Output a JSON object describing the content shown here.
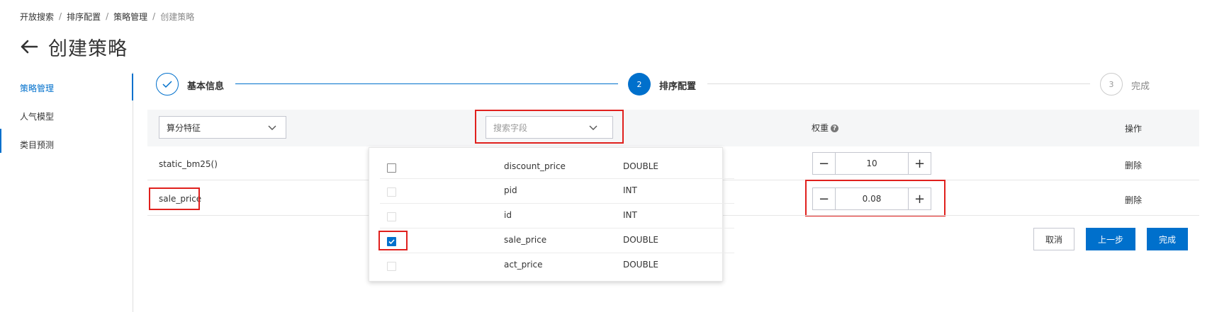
{
  "breadcrumb": [
    "开放搜索",
    "排序配置",
    "策略管理",
    "创建策略"
  ],
  "breadcrumb_sep": "/",
  "page_title": "创建策略",
  "sidebar": {
    "items": [
      {
        "label": "策略管理",
        "active": true
      },
      {
        "label": "人气模型",
        "active": false
      },
      {
        "label": "类目预测",
        "active": false
      }
    ]
  },
  "steps": [
    {
      "number": "1",
      "label": "基本信息",
      "status": "done"
    },
    {
      "number": "2",
      "label": "排序配置",
      "status": "current"
    },
    {
      "number": "3",
      "label": "完成",
      "status": "pending"
    }
  ],
  "table": {
    "feature_select": "算分特征",
    "field_search_placeholder": "搜索字段",
    "weight_header": "权重",
    "action_header": "操作",
    "rows": [
      {
        "feature": "static_bm25()",
        "weight": "10",
        "action": "删除"
      },
      {
        "feature": "sale_price",
        "weight": "0.08",
        "action": "删除"
      }
    ]
  },
  "dropdown": {
    "items": [
      {
        "name": "discount_price",
        "type": "DOUBLE",
        "checked": false,
        "disabled": false
      },
      {
        "name": "pid",
        "type": "INT",
        "checked": false,
        "disabled": true
      },
      {
        "name": "id",
        "type": "INT",
        "checked": false,
        "disabled": true
      },
      {
        "name": "sale_price",
        "type": "DOUBLE",
        "checked": true,
        "disabled": false
      },
      {
        "name": "act_price",
        "type": "DOUBLE",
        "checked": false,
        "disabled": true
      }
    ]
  },
  "buttons": {
    "cancel": "取消",
    "prev": "上一步",
    "finish": "完成"
  },
  "colors": {
    "primary": "#0070cc",
    "highlight": "#e0201d"
  }
}
